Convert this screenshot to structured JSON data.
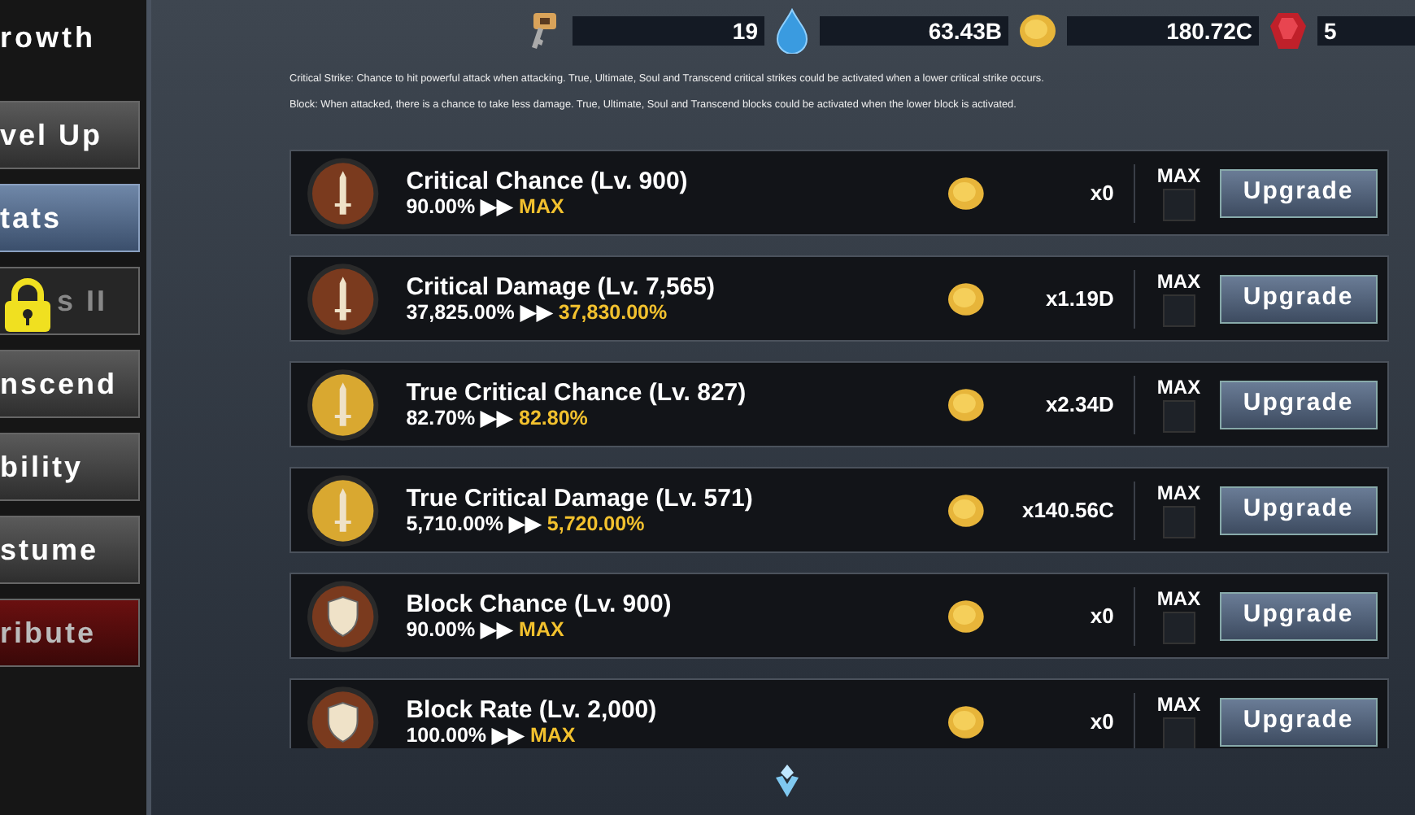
{
  "sidebar": {
    "header": "rowth",
    "tabs": [
      {
        "label": "vel Up",
        "selected": false,
        "locked": false,
        "kind": "normal"
      },
      {
        "label": "tats",
        "selected": true,
        "locked": false,
        "kind": "normal"
      },
      {
        "label": "s II",
        "selected": false,
        "locked": true,
        "kind": "normal"
      },
      {
        "label": "nscend",
        "selected": false,
        "locked": false,
        "kind": "normal"
      },
      {
        "label": "bility",
        "selected": false,
        "locked": false,
        "kind": "normal"
      },
      {
        "label": "stume",
        "selected": false,
        "locked": false,
        "kind": "normal"
      },
      {
        "label": "ribute",
        "selected": false,
        "locked": false,
        "kind": "danger"
      }
    ]
  },
  "currencies": [
    {
      "kind": "key",
      "amount": "19"
    },
    {
      "kind": "drop",
      "amount": "63.43B"
    },
    {
      "kind": "coin",
      "amount": "180.72C"
    },
    {
      "kind": "gem",
      "amount": "5"
    }
  ],
  "description": [
    "Critical Strike: Chance to hit powerful attack when attacking. True, Ultimate, Soul and Transcend critical strikes could be activated when a lower critical strike occurs.",
    "Block: When attacked, there is a chance to take less damage. True, Ultimate, Soul and Transcend blocks could be activated when the lower block is activated."
  ],
  "stats": [
    {
      "title": "Critical Chance (Lv. 900)",
      "current": "90.00%",
      "arrow": "▶▶",
      "next": "MAX",
      "cost": "x0",
      "max_label": "MAX",
      "max_checked": false,
      "button": "Upgrade",
      "kind": "sword",
      "color": "#7a3a1e"
    },
    {
      "title": "Critical Damage (Lv. 7,565)",
      "current": "37,825.00%",
      "arrow": "▶▶",
      "next": "37,830.00%",
      "cost": "x1.19D",
      "max_label": "MAX",
      "max_checked": false,
      "button": "Upgrade",
      "kind": "sword",
      "color": "#7a3a1e"
    },
    {
      "title": "True Critical Chance (Lv. 827)",
      "current": "82.70%",
      "arrow": "▶▶",
      "next": "82.80%",
      "cost": "x2.34D",
      "max_label": "MAX",
      "max_checked": false,
      "button": "Upgrade",
      "kind": "sword",
      "color": "#d9a830"
    },
    {
      "title": "True Critical Damage (Lv. 571)",
      "current": "5,710.00%",
      "arrow": "▶▶",
      "next": "5,720.00%",
      "cost": "x140.56C",
      "max_label": "MAX",
      "max_checked": false,
      "button": "Upgrade",
      "kind": "sword",
      "color": "#d9a830"
    },
    {
      "title": "Block Chance (Lv. 900)",
      "current": "90.00%",
      "arrow": "▶▶",
      "next": "MAX",
      "cost": "x0",
      "max_label": "MAX",
      "max_checked": false,
      "button": "Upgrade",
      "kind": "shield",
      "color": "#7a3a1e"
    },
    {
      "title": "Block Rate (Lv. 2,000)",
      "current": "100.00%",
      "arrow": "▶▶",
      "next": "MAX",
      "cost": "x0",
      "max_label": "MAX",
      "max_checked": false,
      "button": "Upgrade",
      "kind": "shield",
      "color": "#7a3a1e"
    }
  ]
}
